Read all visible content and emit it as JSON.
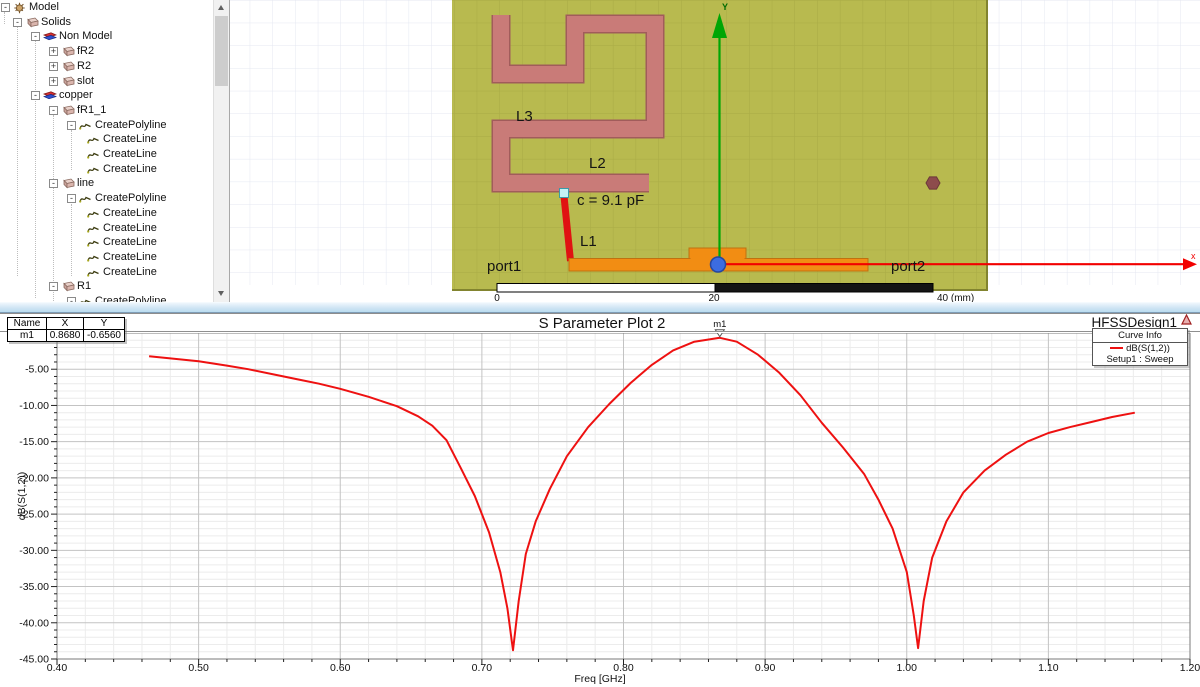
{
  "tree": {
    "items": [
      {
        "label": "Model",
        "icon": "project",
        "expand": "minus",
        "level": 0
      },
      {
        "label": "Solids",
        "icon": "solid",
        "expand": "minus",
        "level": 1
      },
      {
        "label": "Non Model",
        "icon": "sheets",
        "expand": "minus",
        "level": 2
      },
      {
        "label": "fR2",
        "icon": "solid",
        "expand": "plus",
        "level": 3
      },
      {
        "label": "R2",
        "icon": "solid",
        "expand": "plus",
        "level": 3
      },
      {
        "label": "slot",
        "icon": "solid",
        "expand": "plus",
        "level": 3
      },
      {
        "label": "copper",
        "icon": "sheets",
        "expand": "minus",
        "level": 2
      },
      {
        "label": "fR1_1",
        "icon": "solid",
        "expand": "minus",
        "level": 3
      },
      {
        "label": "CreatePolyline",
        "icon": "polyline",
        "expand": "minus",
        "level": 4
      },
      {
        "label": "CreateLine",
        "icon": "polyline",
        "expand": null,
        "level": 5
      },
      {
        "label": "CreateLine",
        "icon": "polyline",
        "expand": null,
        "level": 5
      },
      {
        "label": "CreateLine",
        "icon": "polyline",
        "expand": null,
        "level": 5
      },
      {
        "label": "line",
        "icon": "solid",
        "expand": "minus",
        "level": 3
      },
      {
        "label": "CreatePolyline",
        "icon": "polyline",
        "expand": "minus",
        "level": 4
      },
      {
        "label": "CreateLine",
        "icon": "polyline",
        "expand": null,
        "level": 5
      },
      {
        "label": "CreateLine",
        "icon": "polyline",
        "expand": null,
        "level": 5
      },
      {
        "label": "CreateLine",
        "icon": "polyline",
        "expand": null,
        "level": 5
      },
      {
        "label": "CreateLine",
        "icon": "polyline",
        "expand": null,
        "level": 5
      },
      {
        "label": "CreateLine",
        "icon": "polyline",
        "expand": null,
        "level": 5
      },
      {
        "label": "R1",
        "icon": "solid",
        "expand": "minus",
        "level": 3
      },
      {
        "label": "CreatePolyline",
        "icon": "polyline",
        "expand": "minus",
        "level": 4
      }
    ]
  },
  "model": {
    "labels": {
      "l1": "L1",
      "l2": "L2",
      "l3": "L3",
      "cap": "c = 9.1 pF",
      "port1": "port1",
      "port2": "port2"
    },
    "ruler": {
      "t0": "0",
      "t20": "20",
      "t40": "40 (mm)"
    },
    "axis": {
      "x": "x",
      "y": "Y"
    },
    "colors": {
      "board": "#b8ba4f",
      "meander_trace": "#c97b78",
      "feed_trace": "#f28d13",
      "capacitor_line": "#e01212",
      "x_axis": "#f20000",
      "y_axis": "#00a605"
    }
  },
  "plot": {
    "design_name": "HFSSDesign1",
    "marker_table": {
      "headers": [
        "Name",
        "X",
        "Y"
      ],
      "rows": [
        [
          "m1",
          "0.8680",
          "-0.6560"
        ]
      ]
    },
    "legend": {
      "header": "Curve Info",
      "series_label": "dB(S(1,2))",
      "setup_label": "Setup1 : Sweep"
    }
  },
  "chart_data": {
    "type": "line",
    "title": "S Parameter Plot 2",
    "xlabel": "Freq [GHz]",
    "ylabel": "dB(S(1,2))",
    "xlim": [
      0.4,
      1.2
    ],
    "ylim": [
      -45,
      0
    ],
    "xticks": [
      "0.40",
      "0.50",
      "0.60",
      "0.70",
      "0.80",
      "0.90",
      "1.00",
      "1.10",
      "1.20"
    ],
    "yticks": [
      "-5.00",
      "-10.00",
      "-15.00",
      "-20.00",
      "-25.00",
      "-30.00",
      "-35.00",
      "-40.00",
      "-45.00"
    ],
    "x_minor_step": 0.02,
    "y_minor_step": 1,
    "grid": true,
    "legend_position": "top-right",
    "series": [
      {
        "name": "dB(S(1,2))",
        "setup": "Setup1 : Sweep",
        "color": "#ee1111",
        "points": [
          [
            0.465,
            -3.2
          ],
          [
            0.48,
            -3.5
          ],
          [
            0.5,
            -3.9
          ],
          [
            0.52,
            -4.5
          ],
          [
            0.535,
            -5.0
          ],
          [
            0.555,
            -5.8
          ],
          [
            0.57,
            -6.4
          ],
          [
            0.585,
            -7.0
          ],
          [
            0.6,
            -7.7
          ],
          [
            0.62,
            -8.8
          ],
          [
            0.64,
            -10.1
          ],
          [
            0.655,
            -11.5
          ],
          [
            0.665,
            -12.8
          ],
          [
            0.675,
            -14.8
          ],
          [
            0.685,
            -18.6
          ],
          [
            0.695,
            -22.5
          ],
          [
            0.705,
            -27.5
          ],
          [
            0.713,
            -33.0
          ],
          [
            0.718,
            -38.0
          ],
          [
            0.722,
            -43.8
          ],
          [
            0.726,
            -37.0
          ],
          [
            0.731,
            -30.5
          ],
          [
            0.738,
            -26.0
          ],
          [
            0.748,
            -21.5
          ],
          [
            0.76,
            -17.0
          ],
          [
            0.775,
            -13.0
          ],
          [
            0.79,
            -9.8
          ],
          [
            0.805,
            -6.9
          ],
          [
            0.82,
            -4.4
          ],
          [
            0.835,
            -2.4
          ],
          [
            0.85,
            -1.2
          ],
          [
            0.868,
            -0.656
          ],
          [
            0.88,
            -1.2
          ],
          [
            0.895,
            -3.0
          ],
          [
            0.91,
            -5.5
          ],
          [
            0.925,
            -8.6
          ],
          [
            0.94,
            -12.4
          ],
          [
            0.955,
            -15.8
          ],
          [
            0.97,
            -19.5
          ],
          [
            0.98,
            -23.0
          ],
          [
            0.99,
            -27.0
          ],
          [
            1.0,
            -33.0
          ],
          [
            1.005,
            -39.0
          ],
          [
            1.008,
            -43.5
          ],
          [
            1.012,
            -37.0
          ],
          [
            1.018,
            -31.0
          ],
          [
            1.028,
            -26.0
          ],
          [
            1.04,
            -22.0
          ],
          [
            1.055,
            -19.0
          ],
          [
            1.07,
            -16.8
          ],
          [
            1.085,
            -15.0
          ],
          [
            1.1,
            -13.8
          ],
          [
            1.115,
            -13.0
          ],
          [
            1.13,
            -12.3
          ],
          [
            1.145,
            -11.6
          ],
          [
            1.161,
            -11.0
          ]
        ]
      }
    ],
    "markers": [
      {
        "name": "m1",
        "x": 0.868,
        "y": -0.656,
        "x_label": "0.8680",
        "y_label": "-0.6560"
      }
    ]
  }
}
